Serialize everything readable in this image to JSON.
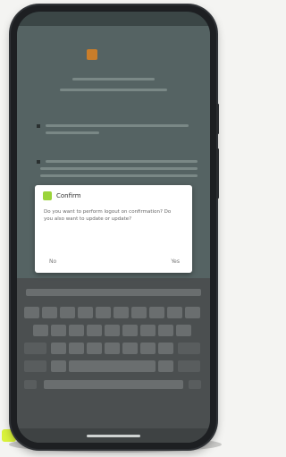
{
  "status_bar": {
    "time": "",
    "right": ""
  },
  "app": {
    "logo_text": ""
  },
  "dialog": {
    "title": "Confirm",
    "body": "Do you want to perform logout on confirmation? Do you also want to update or update?",
    "no_label": "No",
    "yes_label": "Yes"
  },
  "colors": {
    "screen_bg": "#556363",
    "dialog_accent": "#9bd43a",
    "logo_mark": "#c97d2a"
  }
}
